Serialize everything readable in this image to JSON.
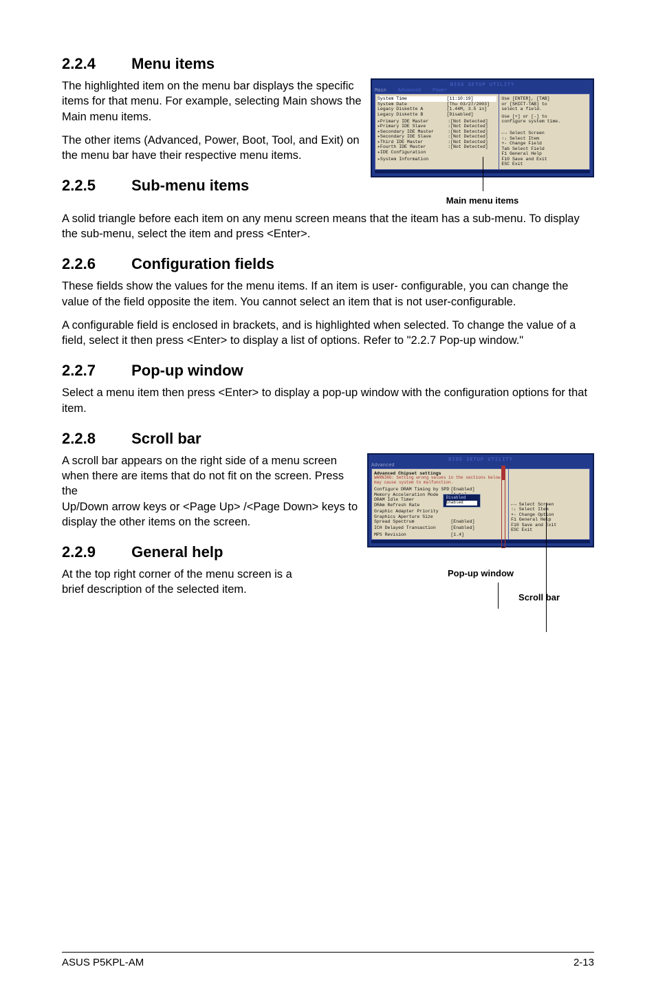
{
  "s224": {
    "num": "2.2.4",
    "title": "Menu items",
    "p1": "The highlighted item on the menu bar displays the specific items for that menu. For example, selecting Main shows the Main menu items.",
    "p2": "The other items (Advanced, Power, Boot, Tool, and Exit) on the menu bar have their respective menu items.",
    "caption": "Main menu items"
  },
  "s225": {
    "num": "2.2.5",
    "title": "Sub-menu items",
    "p1": "A solid triangle before each item on any menu screen means that the iteam has a sub-menu. To display the sub-menu, select the item and press <Enter>."
  },
  "s226": {
    "num": "2.2.6",
    "title": "Configuration fields",
    "p1": "These fields show the values for the menu items. If an item is user- configurable, you can change the value of the field opposite the item. You cannot select an item that is not user-configurable.",
    "p2": "A configurable field is enclosed in brackets, and is highlighted when selected. To change the value of a field, select it then press <Enter> to display a list of options. Refer to \"2.2.7 Pop-up window.\""
  },
  "s227": {
    "num": "2.2.7",
    "title": "Pop-up window",
    "p1": "Select a menu item then press <Enter> to display a pop-up window with the configuration options for that item."
  },
  "s228": {
    "num": "2.2.8",
    "title": "Scroll bar",
    "p1": "A scroll bar appears on the right side of a menu screen when there are items that do not fit on the screen. Press the",
    "p2": "Up/Down arrow keys or <Page Up> /<Page Down> keys to display the other items on the screen."
  },
  "s229": {
    "num": "2.2.9",
    "title": "General help",
    "p1": "At the top right corner of the menu screen is a brief description of the selected item.",
    "caption1": "Pop-up window",
    "caption2": "Scroll bar"
  },
  "bios1": {
    "header": "BIOS SETUP UTILITY",
    "tab_main": "Main",
    "tab_advanced": "Advanced",
    "tab_power": "Power",
    "items": [
      {
        "k": "System Time",
        "v": "[11:10:19]"
      },
      {
        "k": "System Date",
        "v": "[Thu 03/27/2003]"
      },
      {
        "k": "Legacy Diskette A",
        "v": "[1.44M, 3.5 in]"
      },
      {
        "k": "Legacy Diskette B",
        "v": "[Disabled]"
      }
    ],
    "subitems": [
      {
        "k": "Primary IDE Master",
        "v": ":[Not Detected]"
      },
      {
        "k": "Primary IDE Slave",
        "v": ":[Not Detected]"
      },
      {
        "k": "Secondary IDE Master",
        "v": ":[Not Detected]"
      },
      {
        "k": "Secondary IDE Slave",
        "v": ":[Not Detected]"
      },
      {
        "k": "Third IDE Master",
        "v": ":[Not Detected]"
      },
      {
        "k": "Fourth IDE Master",
        "v": ":[Not Detected]"
      },
      {
        "k": "IDE Configuration",
        "v": ""
      }
    ],
    "sysinfo": "System Information",
    "help1": "Use [ENTER], [TAB]",
    "help2": "or [SHIFT-TAB] to",
    "help3": "select a field.",
    "help4": "Use [+] or [-] to",
    "help5": "configure system time.",
    "nav": [
      "←→   Select Screen",
      "↑↓   Select Item",
      "+-   Change Field",
      "Tab  Select Field",
      "F1   General Help",
      "F10  Save and Exit",
      "ESC  Exit"
    ]
  },
  "bios2": {
    "header": "BIOS SETUP UTILITY",
    "tab": "Advanced",
    "section": "Advanced Chipset settings",
    "warn": "WARNING: Setting wrong values in the sections below may cause system to malfunction.",
    "items": [
      {
        "k": "Configure DRAM Timing by SPD",
        "v": "[Enabled]"
      },
      {
        "k": "Memory Acceleration Mode",
        "v": "[Auto]"
      },
      {
        "k": "DRAM Idle Timer",
        "v": ""
      },
      {
        "k": "DRAm Refresh Rate",
        "v": ""
      },
      {
        "k": "Graphic Adapter Priority",
        "v": ""
      },
      {
        "k": "Graphics Aperture Size",
        "v": ""
      },
      {
        "k": "Spread Spectrum",
        "v": "[Enabled]"
      },
      {
        "k": "ICH Delayed Transaction",
        "v": "[Enabled]"
      },
      {
        "k": "MPS Revision",
        "v": "[1.4]"
      }
    ],
    "popup": [
      "Disabled",
      "Enabled"
    ],
    "nav": [
      "←→   Select Screen",
      "↑↓   Select Item",
      "+-   Change Option",
      "F1   General Help",
      "F10  Save and Exit",
      "ESC  Exit"
    ]
  },
  "footer": {
    "left": "ASUS P5KPL-AM",
    "right": "2-13"
  }
}
